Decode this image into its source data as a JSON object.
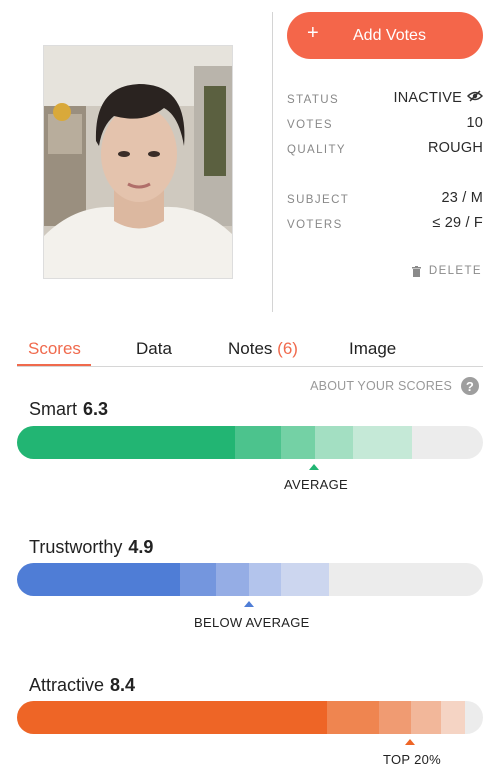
{
  "header": {
    "add_votes_label": "Add Votes",
    "add_icon": "+"
  },
  "stats": {
    "status_label": "STATUS",
    "status_value": "INACTIVE",
    "votes_label": "VOTES",
    "votes_value": "10",
    "quality_label": "QUALITY",
    "quality_value": "ROUGH",
    "subject_label": "SUBJECT",
    "subject_value": "23 / M",
    "voters_label": "VOTERS",
    "voters_value": "≤ 29 / F",
    "delete_label": "DELETE"
  },
  "tabs": {
    "scores": "Scores",
    "data": "Data",
    "notes": "Notes",
    "notes_count": "(6)",
    "image": "Image"
  },
  "about_scores": "ABOUT YOUR SCORES",
  "scores": [
    {
      "label": "Smart",
      "value": "6.3",
      "verdict": "AVERAGE",
      "color": "#22b573"
    },
    {
      "label": "Trustworthy",
      "value": "4.9",
      "verdict": "BELOW AVERAGE",
      "color": "#4f7dd6"
    },
    {
      "label": "Attractive",
      "value": "8.4",
      "verdict": "TOP 20%",
      "color": "#ee6526"
    }
  ],
  "colors": {
    "accent": "#f4664a",
    "smart": "#22b573",
    "trustworthy": "#4f7dd6",
    "attractive": "#ee6526",
    "track": "#ececec"
  }
}
